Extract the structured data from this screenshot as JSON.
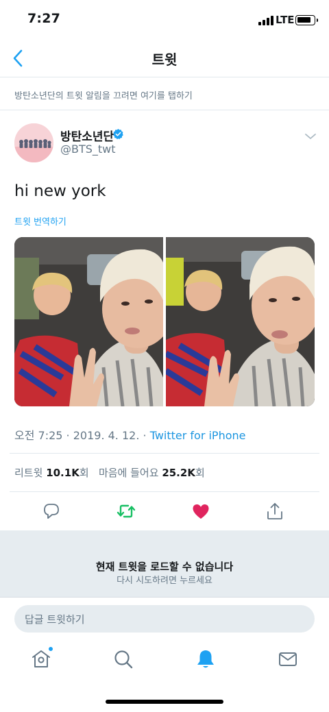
{
  "status_bar": {
    "time": "7:27",
    "network": "LTE"
  },
  "nav": {
    "title": "트윗"
  },
  "notice": {
    "text": "방탄소년단의 트윗 알림을 끄려면 여기를 탭하기"
  },
  "author": {
    "name": "방탄소년단",
    "handle": "@BTS_twt",
    "verified": true
  },
  "tweet": {
    "text": "hi new york",
    "translate_label": "트윗 번역하기",
    "time": "오전 7:25",
    "date": "2019. 4. 12.",
    "separator": " · ",
    "source": "Twitter for iPhone"
  },
  "stats": {
    "retweets_label": "리트윗",
    "retweets_count": "10.1K",
    "retweets_suffix": "회",
    "likes_label": "마음에 들어요",
    "likes_count": "25.2K",
    "likes_suffix": "회"
  },
  "load_error": {
    "title": "현재 트윗을 로드할 수 없습니다",
    "subtitle": "다시 시도하려면 누르세요"
  },
  "reply": {
    "placeholder": "답글 트윗하기"
  },
  "colors": {
    "accent": "#1da1f2",
    "retweet": "#17bf63",
    "like": "#e0245e"
  },
  "icons": {
    "actions": [
      "reply-icon",
      "retweet-icon",
      "like-icon",
      "share-icon"
    ],
    "tabs": [
      "home-icon",
      "search-icon",
      "notifications-icon",
      "messages-icon"
    ]
  }
}
